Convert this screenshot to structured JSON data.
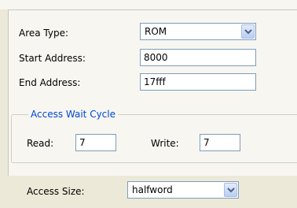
{
  "form": {
    "area_type": {
      "label": "Area Type:",
      "value": "ROM"
    },
    "start_address": {
      "label": "Start Address:",
      "value": "8000"
    },
    "end_address": {
      "label": "End Address:",
      "value": "17fff"
    },
    "access_wait_cycle": {
      "title": "Access Wait Cycle",
      "read": {
        "label": "Read:",
        "value": "7"
      },
      "write": {
        "label": "Write:",
        "value": "7"
      }
    },
    "access_size": {
      "label": "Access Size:",
      "value": "halfword"
    }
  },
  "icons": {
    "dropdown": "chevron-down-icon"
  },
  "colors": {
    "background": "#ece9d8",
    "panel": "#f7f6f1",
    "group_title": "#0046d5",
    "field_border": "#7f9db9"
  }
}
